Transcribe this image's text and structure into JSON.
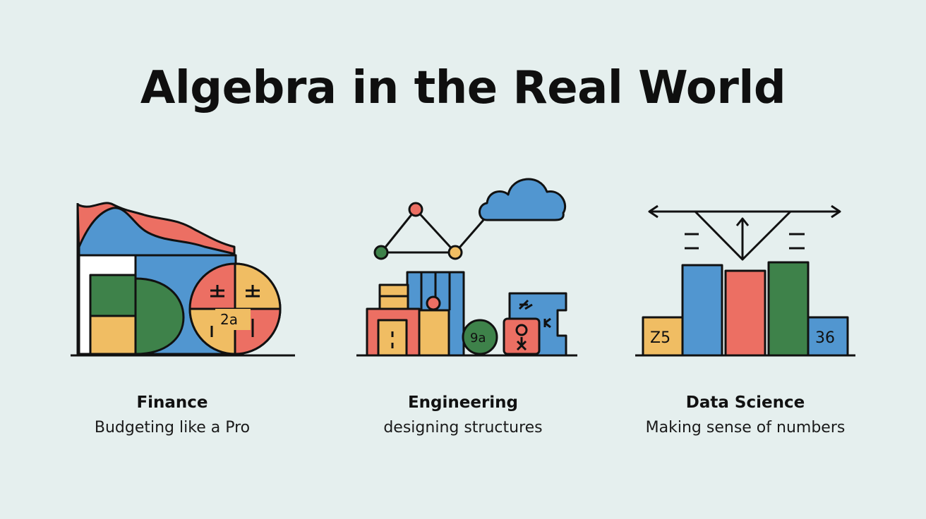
{
  "title": "Algebra in the Real World",
  "colors": {
    "background": "#e5efee",
    "blue": "#5196d0",
    "red": "#ec6f63",
    "green": "#3e824a",
    "yellow": "#f0bd63",
    "stroke": "#111111"
  },
  "panels": [
    {
      "name": "Finance",
      "subtitle": "Budgeting like a Pro",
      "icon_text": [
        "2a"
      ]
    },
    {
      "name": "Engineering",
      "subtitle": "designing structures",
      "icon_text": [
        "9a"
      ]
    },
    {
      "name": "Data Science",
      "subtitle": "Making sense of numbers",
      "icon_text": [
        "Z5",
        "36"
      ]
    }
  ]
}
